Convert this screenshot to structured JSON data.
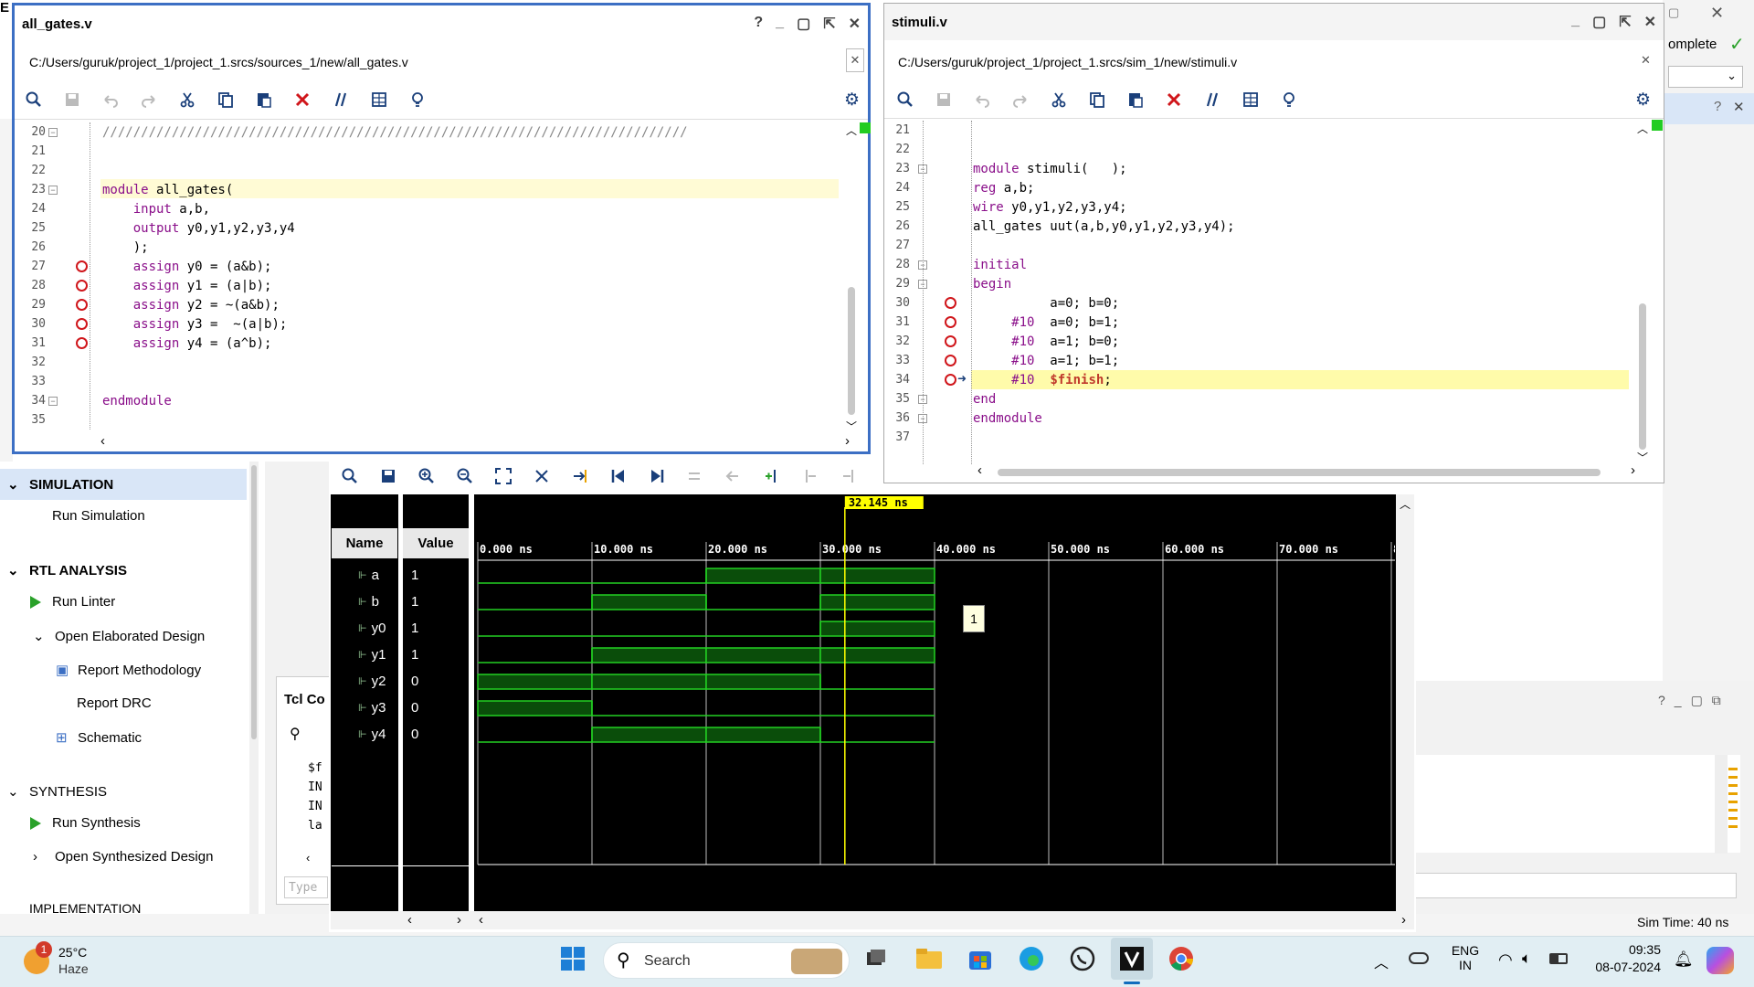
{
  "editor1": {
    "title": "all_gates.v",
    "path": "C:/Users/guruk/project_1/project_1.srcs/sources_1/new/all_gates.v",
    "lines": [
      {
        "n": "20",
        "code": "////////////////////////////////////////////////////////////////////////////"
      },
      {
        "n": "21",
        "code": ""
      },
      {
        "n": "22",
        "code": ""
      },
      {
        "n": "23",
        "code": "module all_gates("
      },
      {
        "n": "24",
        "code": "    input a,b,"
      },
      {
        "n": "25",
        "code": "    output y0,y1,y2,y3,y4"
      },
      {
        "n": "26",
        "code": "    );"
      },
      {
        "n": "27",
        "code": "    assign y0 = (a&b);"
      },
      {
        "n": "28",
        "code": "    assign y1 = (a|b);"
      },
      {
        "n": "29",
        "code": "    assign y2 = ~(a&b);"
      },
      {
        "n": "30",
        "code": "    assign y3 =  ~(a|b);"
      },
      {
        "n": "31",
        "code": "    assign y4 = (a^b);"
      },
      {
        "n": "32",
        "code": ""
      },
      {
        "n": "33",
        "code": ""
      },
      {
        "n": "34",
        "code": "endmodule"
      },
      {
        "n": "35",
        "code": ""
      }
    ]
  },
  "editor2": {
    "title": "stimuli.v",
    "path": "C:/Users/guruk/project_1/project_1.srcs/sim_1/new/stimuli.v",
    "lines": [
      {
        "n": "21",
        "code": ""
      },
      {
        "n": "22",
        "code": ""
      },
      {
        "n": "23",
        "code": "module stimuli(   );"
      },
      {
        "n": "24",
        "code": "reg a,b;"
      },
      {
        "n": "25",
        "code": "wire y0,y1,y2,y3,y4;"
      },
      {
        "n": "26",
        "code": "all_gates uut(a,b,y0,y1,y2,y3,y4);"
      },
      {
        "n": "27",
        "code": ""
      },
      {
        "n": "28",
        "code": "initial"
      },
      {
        "n": "29",
        "code": "begin"
      },
      {
        "n": "30",
        "code": "          a=0; b=0;"
      },
      {
        "n": "31",
        "code": "     #10  a=0; b=1;"
      },
      {
        "n": "32",
        "code": "     #10  a=1; b=0;"
      },
      {
        "n": "33",
        "code": "     #10  a=1; b=1;"
      },
      {
        "n": "34",
        "code": "     #10  $finish;"
      },
      {
        "n": "35",
        "code": "end"
      },
      {
        "n": "36",
        "code": "endmodule"
      },
      {
        "n": "37",
        "code": ""
      }
    ]
  },
  "left_panel": {
    "simulation": "SIMULATION",
    "run_simulation": "Run Simulation",
    "rtl_analysis": "RTL ANALYSIS",
    "run_linter": "Run Linter",
    "open_elaborated": "Open Elaborated Design",
    "report_methodology": "Report Methodology",
    "report_drc": "Report DRC",
    "schematic": "Schematic",
    "synthesis": "SYNTHESIS",
    "run_synthesis": "Run Synthesis",
    "open_synthesized": "Open Synthesized Design",
    "implementation": "IMPLEMENTATION"
  },
  "tcl": {
    "title": "Tcl Co",
    "lines": [
      "$f",
      "IN",
      "IN",
      "la"
    ],
    "placeholder": "Type"
  },
  "waveform": {
    "col_name": "Name",
    "col_value": "Value",
    "cursor_label": "32.145 ns",
    "ticks": [
      "0.000 ns",
      "10.000 ns",
      "20.000 ns",
      "30.000 ns",
      "40.000 ns",
      "50.000 ns",
      "60.000 ns",
      "70.000 ns",
      "8"
    ],
    "tooltip": "1",
    "signals": [
      {
        "name": "a",
        "value": "1",
        "levels": [
          0,
          0,
          1,
          1
        ]
      },
      {
        "name": "b",
        "value": "1",
        "levels": [
          0,
          1,
          0,
          1
        ]
      },
      {
        "name": "y0",
        "value": "1",
        "levels": [
          0,
          0,
          0,
          1
        ]
      },
      {
        "name": "y1",
        "value": "1",
        "levels": [
          0,
          1,
          1,
          1
        ]
      },
      {
        "name": "y2",
        "value": "0",
        "levels": [
          1,
          1,
          1,
          0
        ]
      },
      {
        "name": "y3",
        "value": "0",
        "levels": [
          1,
          0,
          0,
          0
        ]
      },
      {
        "name": "y4",
        "value": "0",
        "levels": [
          0,
          1,
          1,
          0
        ]
      }
    ]
  },
  "background_window": {
    "complete_text": "omplete"
  },
  "status": {
    "sim_time": "Sim Time: 40 ns"
  },
  "taskbar": {
    "weather_temp": "25°C",
    "weather_desc": "Haze",
    "weather_badge": "1",
    "search": "Search",
    "lang1": "ENG",
    "lang2": "IN",
    "time": "09:35",
    "date": "08-07-2024"
  },
  "colors": {
    "accent": "#3c6fc4",
    "wave": "#22d022",
    "cursor": "#ffff00"
  }
}
